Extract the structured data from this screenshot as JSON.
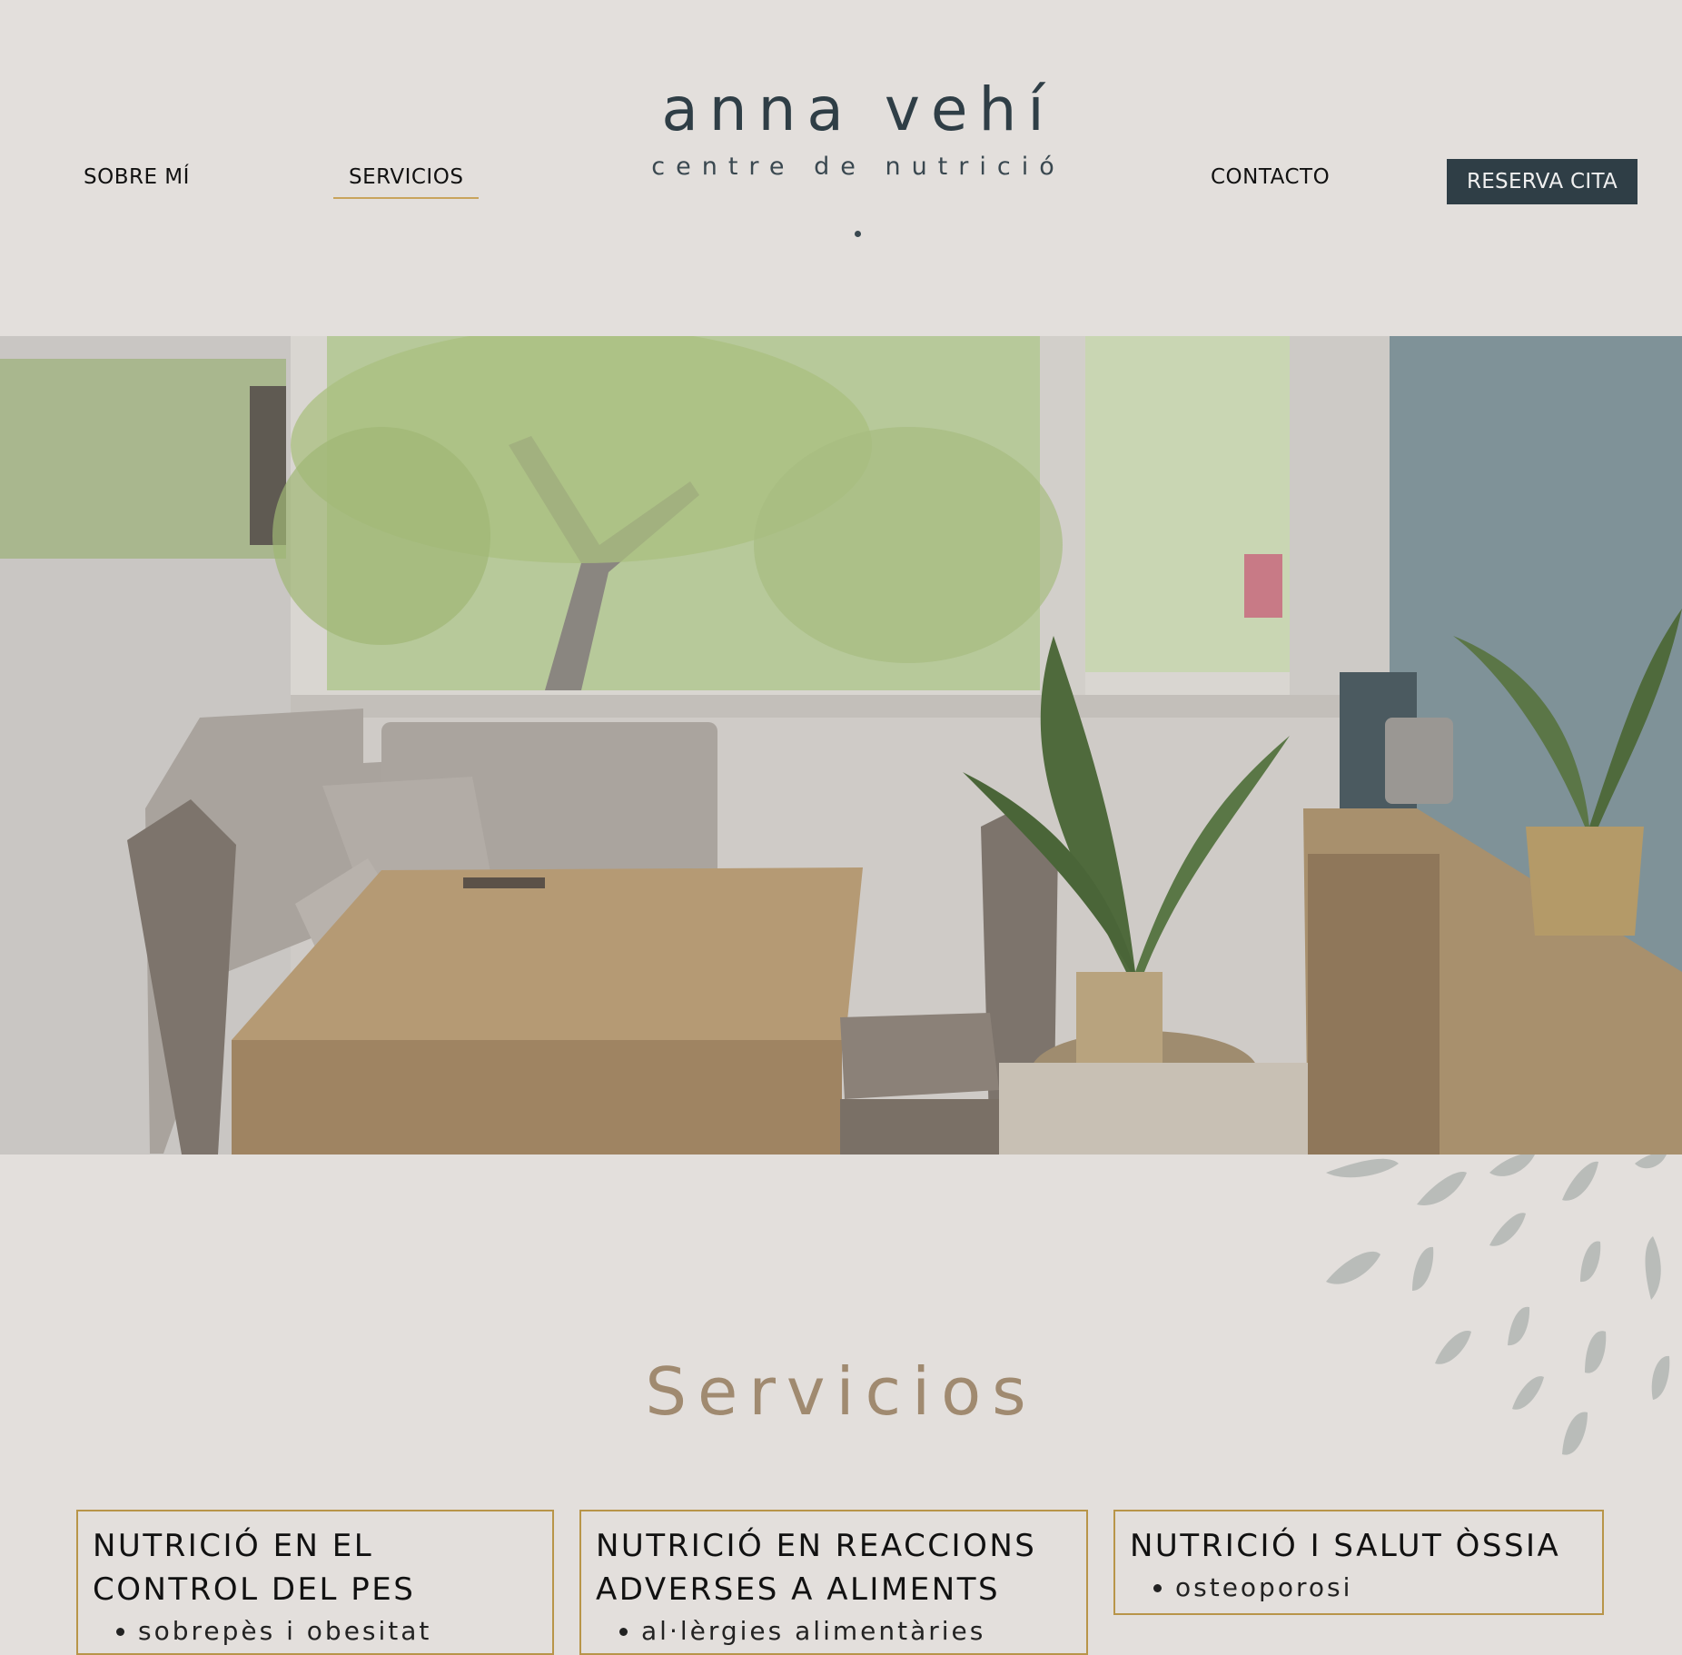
{
  "nav": {
    "sobre_label": "SOBRE MÍ",
    "servicios_label": "SERVICIOS",
    "contacto_label": "CONTACTO",
    "reserva_label": "RESERVA CITA"
  },
  "logo": {
    "name": "anna vehí",
    "subtitle": "centre de nutrició"
  },
  "hero": {
    "image": "consultation-room-photo"
  },
  "services": {
    "title": "Servicios",
    "cards": [
      {
        "title_line1": "NUTRICIÓ EN EL",
        "title_line2": "CONTROL DEL PES",
        "items": [
          "sobrepès i obesitat"
        ]
      },
      {
        "title_line1": "NUTRICIÓ EN REACCIONS",
        "title_line2": "ADVERSES A ALIMENTS",
        "items": [
          "al·lèrgies alimentàries"
        ]
      },
      {
        "title_line1": "NUTRICIÓ I SALUT ÒSSIA",
        "items": [
          "osteoporosi"
        ]
      }
    ]
  },
  "colors": {
    "background": "#e3dfdc",
    "accent_gold": "#b89549",
    "title_brown": "#a08a70",
    "button_dark": "#2f3e46"
  }
}
